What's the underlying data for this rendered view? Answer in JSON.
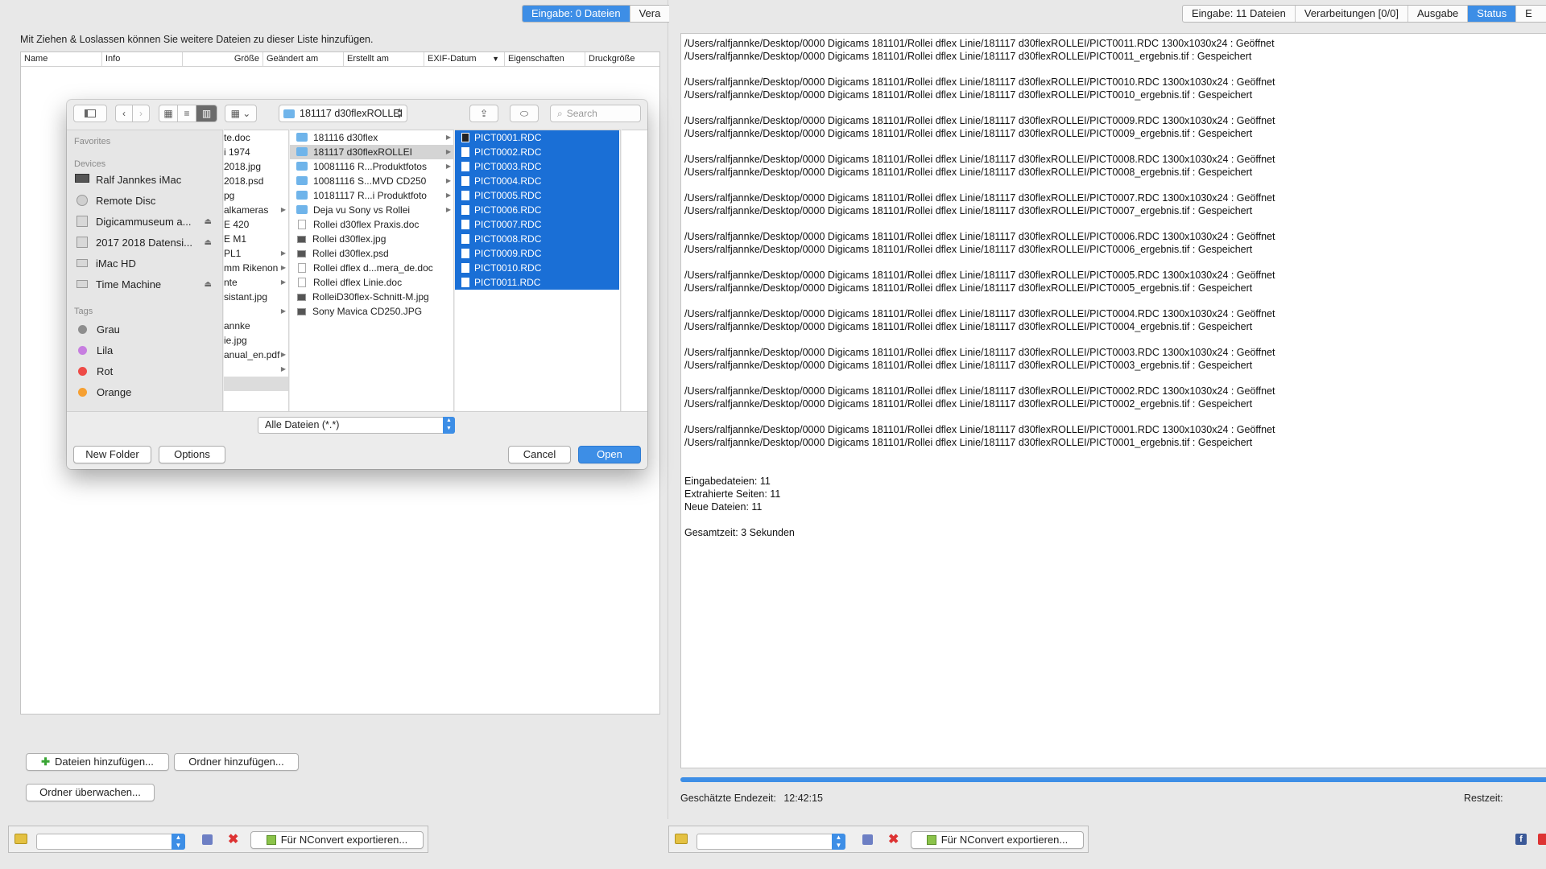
{
  "left_panel": {
    "tabs": [
      "Eingabe: 0 Dateien",
      "Vera"
    ],
    "instruction": "Mit Ziehen & Loslassen können Sie weitere Dateien zu dieser Liste hinzufügen.",
    "columns": [
      "Name",
      "Info",
      "Größe",
      "Geändert am",
      "Erstellt am",
      "EXIF-Datum",
      "Eigenschaften",
      "Druckgröße"
    ],
    "add_files_label": "Dateien hinzufügen...",
    "add_folder_label": "Ordner hinzufügen...",
    "watch_folder_label": "Ordner überwachen...",
    "export_label": "Für NConvert exportieren..."
  },
  "right_panel": {
    "tabs": [
      "Eingabe: 11 Dateien",
      "Verarbeitungen [0/0]",
      "Ausgabe",
      "Status",
      "E"
    ],
    "log_lines": [
      "/Users/ralfjannke/Desktop/0000 Digicams 181101/Rollei dflex Linie/181117 d30flexROLLEI/PICT0011.RDC 1300x1030x24 : Geöffnet",
      "/Users/ralfjannke/Desktop/0000 Digicams 181101/Rollei dflex Linie/181117 d30flexROLLEI/PICT0011_ergebnis.tif : Gespeichert",
      "",
      "/Users/ralfjannke/Desktop/0000 Digicams 181101/Rollei dflex Linie/181117 d30flexROLLEI/PICT0010.RDC 1300x1030x24 : Geöffnet",
      "/Users/ralfjannke/Desktop/0000 Digicams 181101/Rollei dflex Linie/181117 d30flexROLLEI/PICT0010_ergebnis.tif : Gespeichert",
      "",
      "/Users/ralfjannke/Desktop/0000 Digicams 181101/Rollei dflex Linie/181117 d30flexROLLEI/PICT0009.RDC 1300x1030x24 : Geöffnet",
      "/Users/ralfjannke/Desktop/0000 Digicams 181101/Rollei dflex Linie/181117 d30flexROLLEI/PICT0009_ergebnis.tif : Gespeichert",
      "",
      "/Users/ralfjannke/Desktop/0000 Digicams 181101/Rollei dflex Linie/181117 d30flexROLLEI/PICT0008.RDC 1300x1030x24 : Geöffnet",
      "/Users/ralfjannke/Desktop/0000 Digicams 181101/Rollei dflex Linie/181117 d30flexROLLEI/PICT0008_ergebnis.tif : Gespeichert",
      "",
      "/Users/ralfjannke/Desktop/0000 Digicams 181101/Rollei dflex Linie/181117 d30flexROLLEI/PICT0007.RDC 1300x1030x24 : Geöffnet",
      "/Users/ralfjannke/Desktop/0000 Digicams 181101/Rollei dflex Linie/181117 d30flexROLLEI/PICT0007_ergebnis.tif : Gespeichert",
      "",
      "/Users/ralfjannke/Desktop/0000 Digicams 181101/Rollei dflex Linie/181117 d30flexROLLEI/PICT0006.RDC 1300x1030x24 : Geöffnet",
      "/Users/ralfjannke/Desktop/0000 Digicams 181101/Rollei dflex Linie/181117 d30flexROLLEI/PICT0006_ergebnis.tif : Gespeichert",
      "",
      "/Users/ralfjannke/Desktop/0000 Digicams 181101/Rollei dflex Linie/181117 d30flexROLLEI/PICT0005.RDC 1300x1030x24 : Geöffnet",
      "/Users/ralfjannke/Desktop/0000 Digicams 181101/Rollei dflex Linie/181117 d30flexROLLEI/PICT0005_ergebnis.tif : Gespeichert",
      "",
      "/Users/ralfjannke/Desktop/0000 Digicams 181101/Rollei dflex Linie/181117 d30flexROLLEI/PICT0004.RDC 1300x1030x24 : Geöffnet",
      "/Users/ralfjannke/Desktop/0000 Digicams 181101/Rollei dflex Linie/181117 d30flexROLLEI/PICT0004_ergebnis.tif : Gespeichert",
      "",
      "/Users/ralfjannke/Desktop/0000 Digicams 181101/Rollei dflex Linie/181117 d30flexROLLEI/PICT0003.RDC 1300x1030x24 : Geöffnet",
      "/Users/ralfjannke/Desktop/0000 Digicams 181101/Rollei dflex Linie/181117 d30flexROLLEI/PICT0003_ergebnis.tif : Gespeichert",
      "",
      "/Users/ralfjannke/Desktop/0000 Digicams 181101/Rollei dflex Linie/181117 d30flexROLLEI/PICT0002.RDC 1300x1030x24 : Geöffnet",
      "/Users/ralfjannke/Desktop/0000 Digicams 181101/Rollei dflex Linie/181117 d30flexROLLEI/PICT0002_ergebnis.tif : Gespeichert",
      "",
      "/Users/ralfjannke/Desktop/0000 Digicams 181101/Rollei dflex Linie/181117 d30flexROLLEI/PICT0001.RDC 1300x1030x24 : Geöffnet",
      "/Users/ralfjannke/Desktop/0000 Digicams 181101/Rollei dflex Linie/181117 d30flexROLLEI/PICT0001_ergebnis.tif : Gespeichert",
      "",
      "",
      "Eingabedateien: 11",
      "Extrahierte Seiten: 11",
      "Neue Dateien: 11",
      "",
      "Gesamtzeit: 3 Sekunden"
    ],
    "progress": 1.0,
    "estimated_end_label": "Geschätzte Endezeit:",
    "estimated_end_value": "12:42:15",
    "remaining_label": "Restzeit:",
    "export_label": "Für NConvert exportieren..."
  },
  "dialog": {
    "path": "181117 d30flexROLLEI",
    "search_placeholder": "Search",
    "sidebar": {
      "favorites_header": "Favorites",
      "devices_header": "Devices",
      "devices": [
        "Ralf Jannkes iMac",
        "Remote Disc",
        "Digicammuseum a...",
        "2017 2018 Datensi...",
        "iMac HD",
        "Time Machine"
      ],
      "tags_header": "Tags",
      "tags": [
        {
          "name": "Grau",
          "color": "#8e8e8e"
        },
        {
          "name": "Lila",
          "color": "#c77ee0"
        },
        {
          "name": "Rot",
          "color": "#ee4b47"
        },
        {
          "name": "Orange",
          "color": "#f6a032"
        }
      ]
    },
    "col1": [
      "te.doc",
      "i 1974",
      "2018.jpg",
      "2018.psd",
      "pg",
      "alkameras",
      "E 420",
      "E M1",
      "PL1",
      "mm Rikenon",
      "nte",
      "sistant.jpg",
      "",
      "annke",
      "ie.jpg",
      "anual_en.pdf",
      "",
      ""
    ],
    "col2": [
      {
        "name": "181116 d30flex",
        "type": "folder"
      },
      {
        "name": "181117 d30flexROLLEI",
        "type": "folder"
      },
      {
        "name": "10081116 R...Produktfotos",
        "type": "folder"
      },
      {
        "name": "10081116 S...MVD CD250",
        "type": "folder"
      },
      {
        "name": "10181117 R...i Produktfoto",
        "type": "folder"
      },
      {
        "name": "Deja vu Sony vs Rollei",
        "type": "folder"
      },
      {
        "name": "Rollei d30flex Praxis.doc",
        "type": "file"
      },
      {
        "name": "Rollei d30flex.jpg",
        "type": "image"
      },
      {
        "name": "Rollei d30flex.psd",
        "type": "image"
      },
      {
        "name": "Rollei dflex d...mera_de.doc",
        "type": "file"
      },
      {
        "name": "Rollei dflex Linie.doc",
        "type": "file"
      },
      {
        "name": "RolleiD30flex-Schnitt-M.jpg",
        "type": "image"
      },
      {
        "name": "Sony Mavica CD250.JPG",
        "type": "image"
      }
    ],
    "col3": [
      "PICT0001.RDC",
      "PICT0002.RDC",
      "PICT0003.RDC",
      "PICT0004.RDC",
      "PICT0005.RDC",
      "PICT0006.RDC",
      "PICT0007.RDC",
      "PICT0008.RDC",
      "PICT0009.RDC",
      "PICT0010.RDC",
      "PICT0011.RDC"
    ],
    "filter": "Alle Dateien (*.*)",
    "new_folder_label": "New Folder",
    "options_label": "Options",
    "cancel_label": "Cancel",
    "open_label": "Open"
  },
  "colors": {
    "accent": "#3d8ee6",
    "selection": "#1a6fd6"
  }
}
